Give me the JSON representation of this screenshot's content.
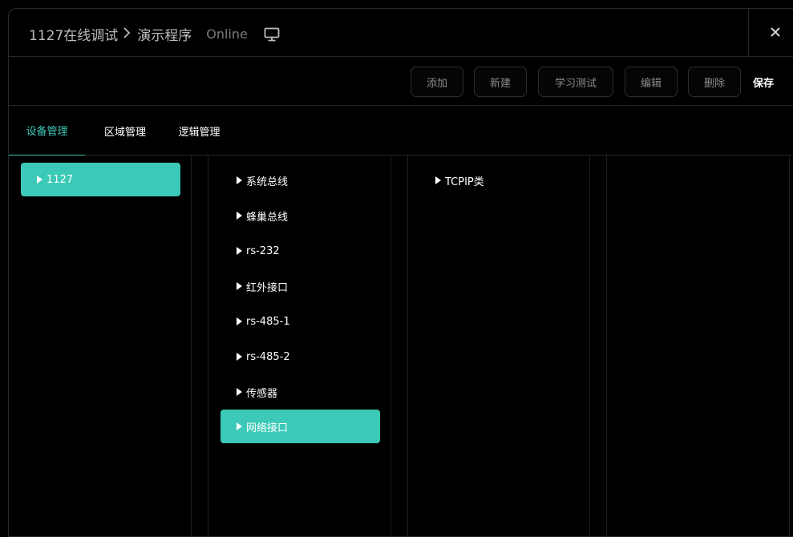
{
  "header": {
    "project": "1127在线调试",
    "separator": ">",
    "program": "演示程序",
    "status": "Online"
  },
  "toolbar": {
    "add_label": "添加",
    "new_label": "新建",
    "learn_test_label": "学习测试",
    "edit_label": "编辑",
    "delete_label": "删除",
    "save_label": "保存"
  },
  "tabs": [
    {
      "label": "设备管理",
      "active": true
    },
    {
      "label": "区域管理",
      "active": false
    },
    {
      "label": "逻辑管理",
      "active": false
    }
  ],
  "columns": {
    "devices": [
      {
        "label": "1127",
        "selected": true
      }
    ],
    "buses": [
      {
        "label": "系统总线",
        "selected": false
      },
      {
        "label": "蜂巢总线",
        "selected": false
      },
      {
        "label": "rs-232",
        "selected": false
      },
      {
        "label": "红外接口",
        "selected": false
      },
      {
        "label": "rs-485-1",
        "selected": false
      },
      {
        "label": "rs-485-2",
        "selected": false
      },
      {
        "label": "传感器",
        "selected": false
      },
      {
        "label": "网络接口",
        "selected": true
      }
    ],
    "categories": [
      {
        "label": "TCPIP类",
        "selected": false
      }
    ]
  },
  "colors": {
    "accent": "#3cc9b8",
    "background": "#000000",
    "border": "#262626"
  },
  "icons": {
    "monitor": "monitor-icon",
    "close": "close-icon",
    "caret": "caret-right-icon",
    "chevron": "chevron-right-icon"
  }
}
